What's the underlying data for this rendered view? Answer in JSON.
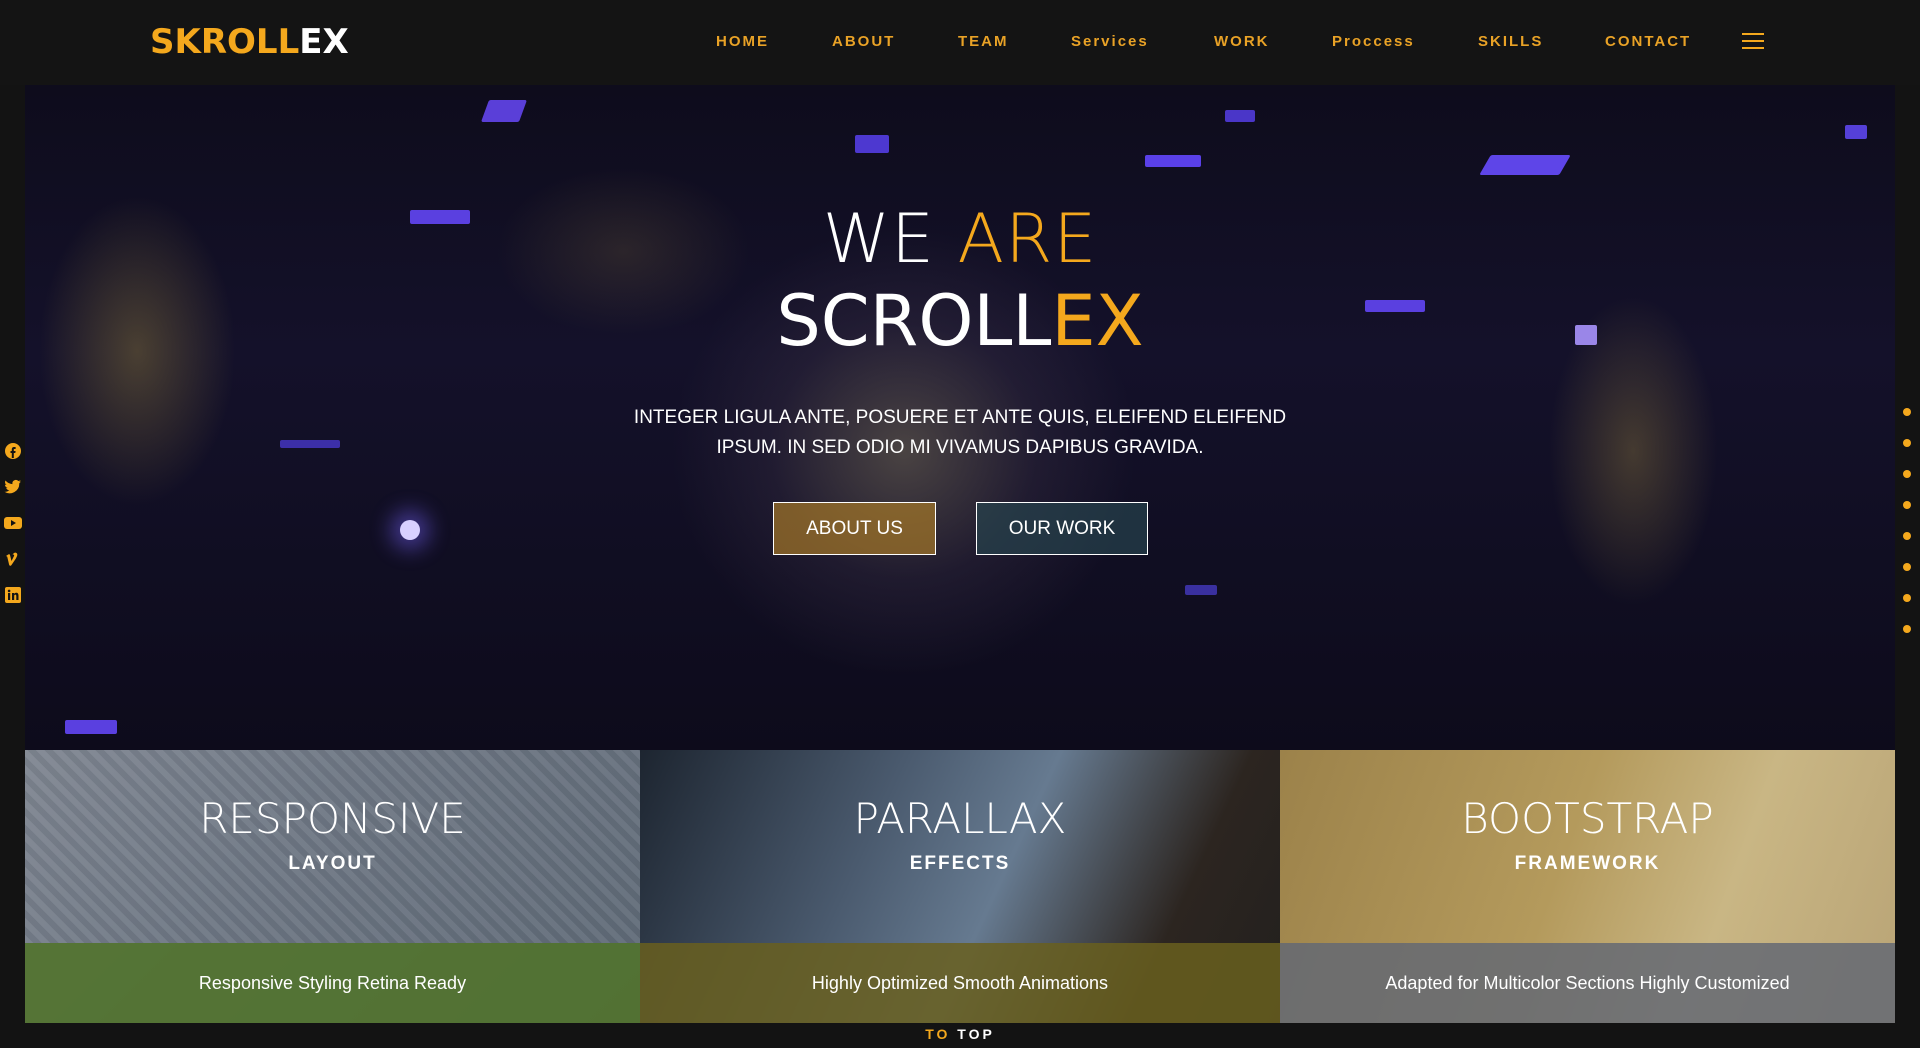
{
  "brand": {
    "logo_part1": "SKROLL",
    "logo_part2": "EX",
    "accent": "#f4a81d"
  },
  "nav": {
    "items": [
      "HOME",
      "ABOUT",
      "TEAM",
      "Services",
      "WORK",
      "Proccess",
      "SKILLS",
      "CONTACT"
    ],
    "menu_icon": "hamburger-menu-icon"
  },
  "hero": {
    "title_line1_a": "WE",
    "title_line1_b": "ARE",
    "title_line2_a": "SCROLL",
    "title_line2_b": "EX",
    "text": "INTEGER LIGULA ANTE, POSUERE ET ANTE QUIS, ELEIFEND ELEIFEND IPSUM. IN SED ODIO MI VIVAMUS DAPIBUS GRAVIDA.",
    "button_about": "ABOUT US",
    "button_work": "OUR WORK"
  },
  "social": [
    "facebook-icon",
    "twitter-icon",
    "youtube-icon",
    "vimeo-icon",
    "linkedin-icon"
  ],
  "section_dots": 8,
  "features": [
    {
      "title": "RESPONSIVE",
      "subtitle": "LAYOUT",
      "text": "Responsive Styling Retina Ready"
    },
    {
      "title": "PARALLAX",
      "subtitle": "EFFECTS",
      "text": "Highly Optimized Smooth Animations"
    },
    {
      "title": "BOOTSTRAP",
      "subtitle": "FRAMEWORK",
      "text": "Adapted for Multicolor Sections Highly Customized"
    }
  ],
  "to_top": {
    "part1": "TO",
    "part2": "TOP"
  }
}
